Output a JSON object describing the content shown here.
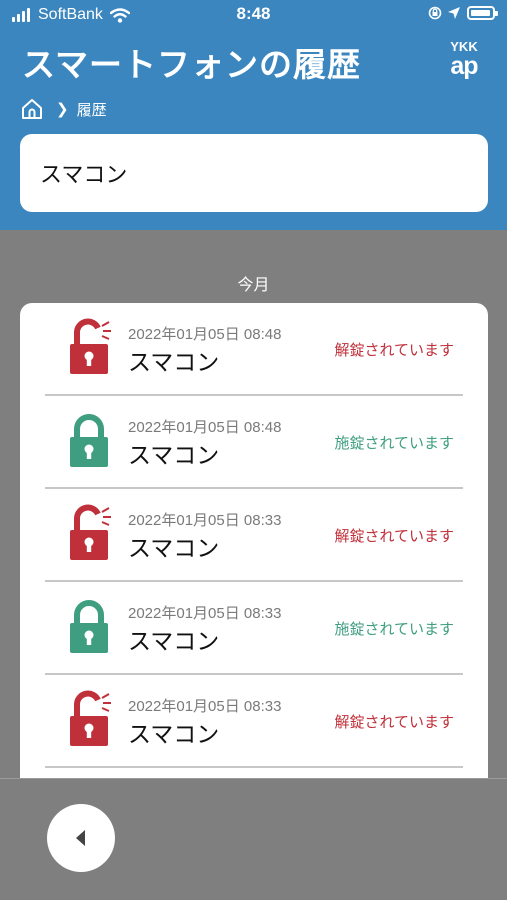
{
  "status_bar": {
    "carrier": "SoftBank",
    "time": "8:48"
  },
  "header": {
    "title": "スマートフォンの履歴",
    "logo_line1": "YKK",
    "logo_line2": "ap"
  },
  "breadcrumb": {
    "current": "履歴"
  },
  "device": {
    "name": "スマコン"
  },
  "month_label": "今月",
  "colors": {
    "header": "#3b86bf",
    "unlocked": "#c0303a",
    "locked": "#3f9e80"
  },
  "history": [
    {
      "datetime": "2022年01月05日 08:48",
      "name": "スマコン",
      "status": "解錠されています",
      "state": "unlocked",
      "icon": "unlocked-padlock-icon"
    },
    {
      "datetime": "2022年01月05日 08:48",
      "name": "スマコン",
      "status": "施錠されています",
      "state": "locked",
      "icon": "locked-padlock-icon"
    },
    {
      "datetime": "2022年01月05日 08:33",
      "name": "スマコン",
      "status": "解錠されています",
      "state": "unlocked",
      "icon": "unlocked-padlock-icon"
    },
    {
      "datetime": "2022年01月05日 08:33",
      "name": "スマコン",
      "status": "施錠されています",
      "state": "locked",
      "icon": "locked-padlock-icon"
    },
    {
      "datetime": "2022年01月05日 08:33",
      "name": "スマコン",
      "status": "解錠されています",
      "state": "unlocked",
      "icon": "unlocked-padlock-icon"
    }
  ]
}
